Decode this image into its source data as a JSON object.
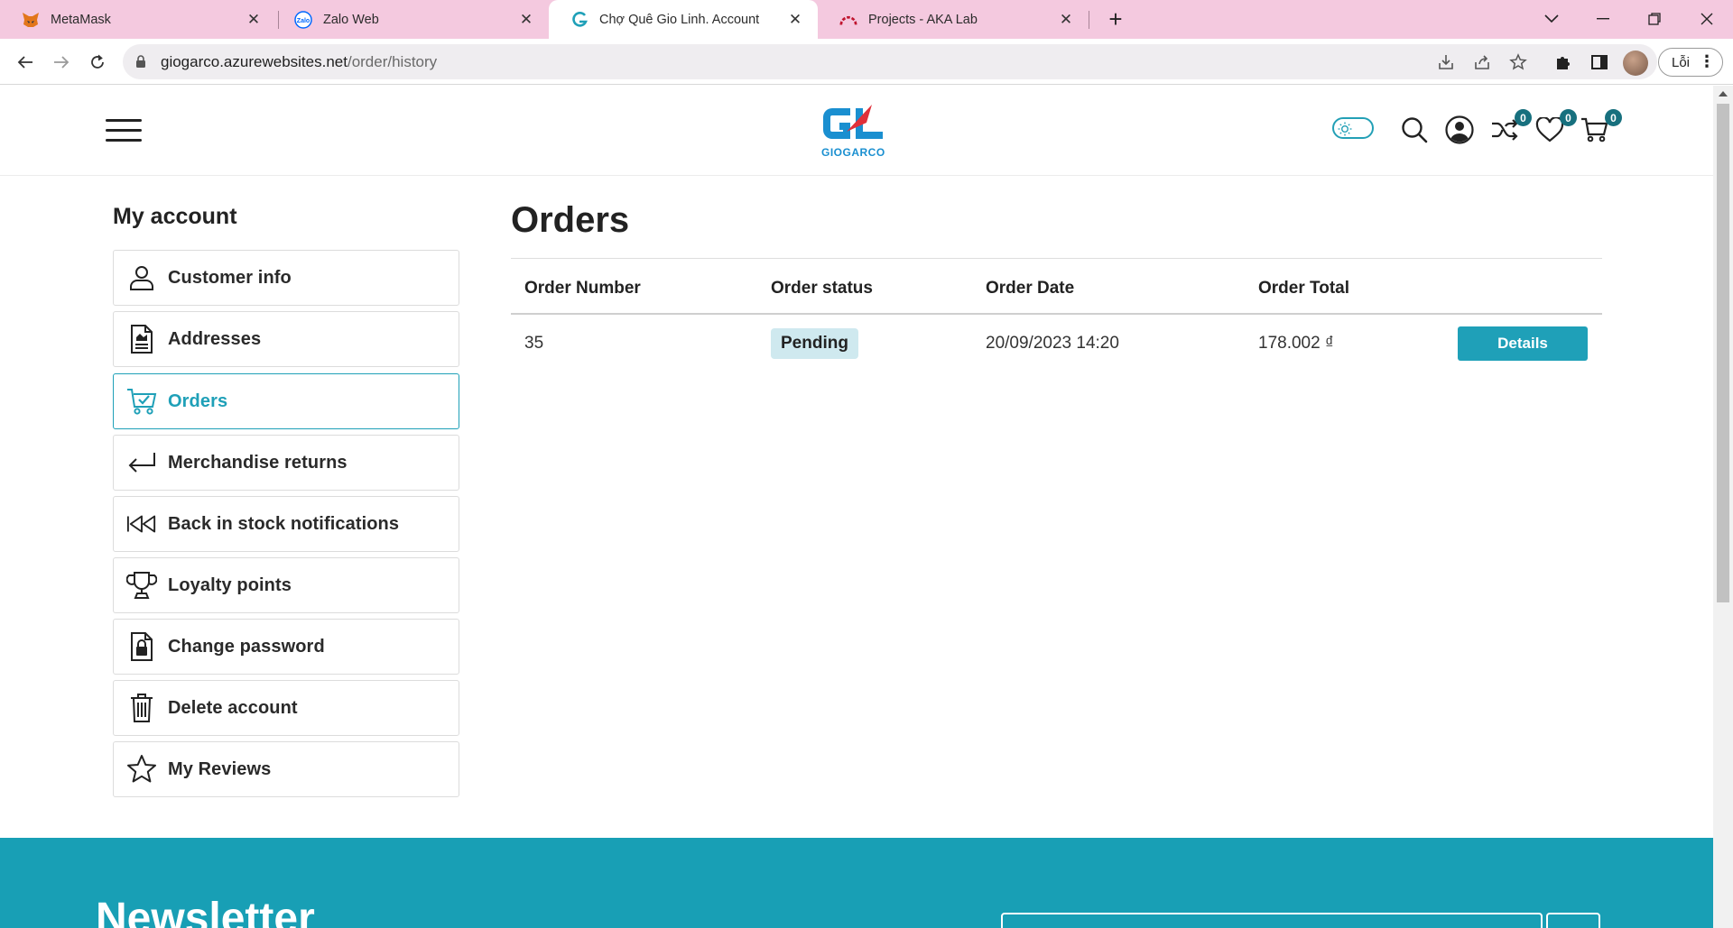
{
  "browser": {
    "tabs": [
      {
        "title": "MetaMask",
        "icon": "metamask-fox-icon",
        "active": false
      },
      {
        "title": "Zalo Web",
        "icon": "zalo-icon",
        "active": false
      },
      {
        "title": "Chợ Quê Gio Linh. Account",
        "icon": "giogarco-g-icon",
        "active": true
      },
      {
        "title": "Projects - AKA Lab",
        "icon": "aka-lab-icon",
        "active": false
      }
    ],
    "url_host": "giogarco.azurewebsites.net",
    "url_path": "/order/history",
    "profile_label": "Lỗi"
  },
  "header": {
    "logo_text": "GIOGARCO",
    "compare_count": "0",
    "wishlist_count": "0",
    "cart_count": "0",
    "accent_color": "#1fa0b8"
  },
  "sidebar": {
    "title": "My account",
    "items": [
      {
        "label": "Customer info",
        "icon": "user-icon",
        "active": false
      },
      {
        "label": "Addresses",
        "icon": "address-document-icon",
        "active": false
      },
      {
        "label": "Orders",
        "icon": "cart-check-icon",
        "active": true
      },
      {
        "label": "Merchandise returns",
        "icon": "return-arrow-icon",
        "active": false
      },
      {
        "label": "Back in stock notifications",
        "icon": "rewind-icon",
        "active": false
      },
      {
        "label": "Loyalty points",
        "icon": "trophy-icon",
        "active": false
      },
      {
        "label": "Change password",
        "icon": "lock-document-icon",
        "active": false
      },
      {
        "label": "Delete account",
        "icon": "trash-icon",
        "active": false
      },
      {
        "label": "My Reviews",
        "icon": "star-icon",
        "active": false
      }
    ]
  },
  "orders": {
    "title": "Orders",
    "columns": [
      "Order Number",
      "Order status",
      "Order Date",
      "Order Total"
    ],
    "rows": [
      {
        "number": "35",
        "status": "Pending",
        "date": "20/09/2023 14:20",
        "total": "178.002 ₫",
        "action": "Details"
      }
    ]
  },
  "newsletter": {
    "title": "Newsletter"
  }
}
